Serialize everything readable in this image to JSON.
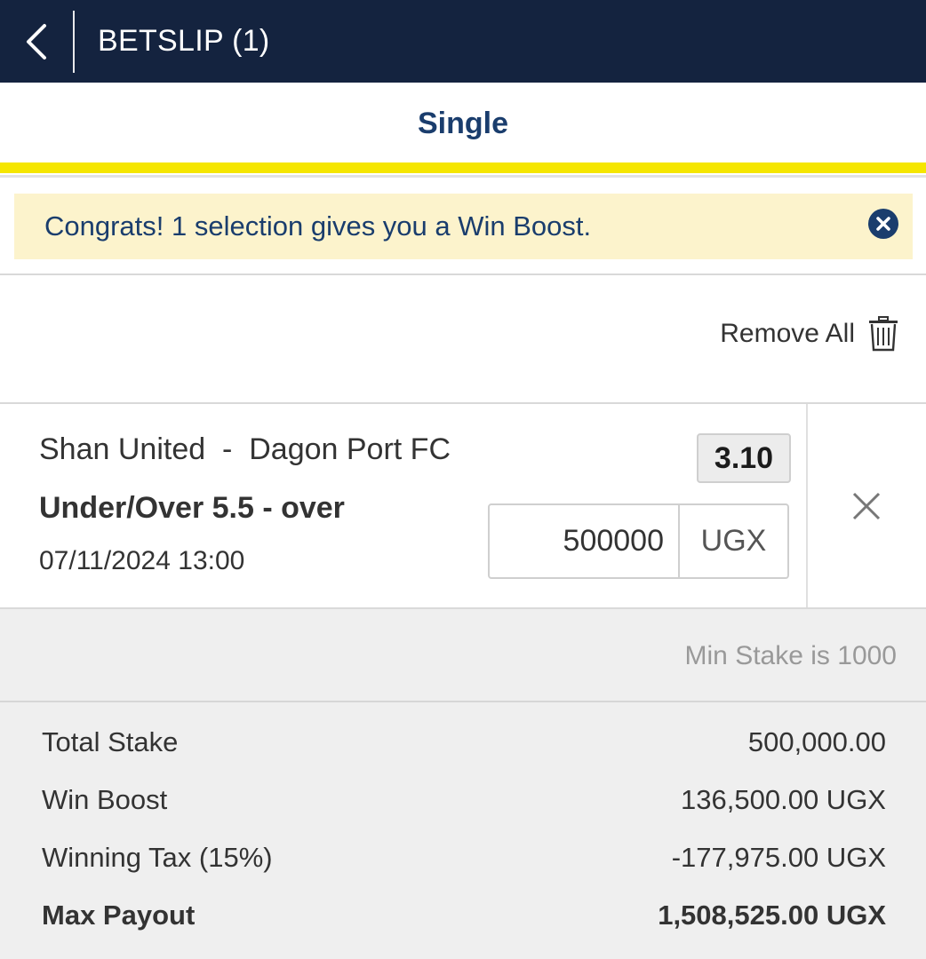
{
  "header": {
    "title": "BETSLIP (1)",
    "back_icon": "chevron-left-icon"
  },
  "tabs": [
    {
      "label": "Single",
      "active": true
    }
  ],
  "notice": {
    "text": "Congrats! 1 selection gives you a Win Boost.",
    "close_icon": "close-circle-icon"
  },
  "actions": {
    "remove_all_label": "Remove All",
    "remove_all_icon": "trash-icon"
  },
  "selection": {
    "match": "Shan United  -  Dagon Port FC",
    "market": "Under/Over 5.5 - over",
    "datetime": "07/11/2024 13:00",
    "odds": "3.10",
    "stake_value": "500000",
    "currency": "UGX",
    "remove_icon": "close-icon"
  },
  "info": {
    "min_stake": "Min Stake is 1000"
  },
  "summary": [
    {
      "label": "Total Stake",
      "value": "500,000.00"
    },
    {
      "label": "Win Boost",
      "value": "136,500.00 UGX"
    },
    {
      "label": "Winning Tax (15%)",
      "value": "-177,975.00 UGX"
    },
    {
      "label": "Max Payout",
      "value": "1,508,525.00 UGX"
    }
  ],
  "colors": {
    "header_bg": "#14233f",
    "accent_blue": "#1a3d6d",
    "tab_underline": "#f5e600",
    "notice_bg": "#fcf3cc",
    "summary_bg": "#efefef"
  }
}
